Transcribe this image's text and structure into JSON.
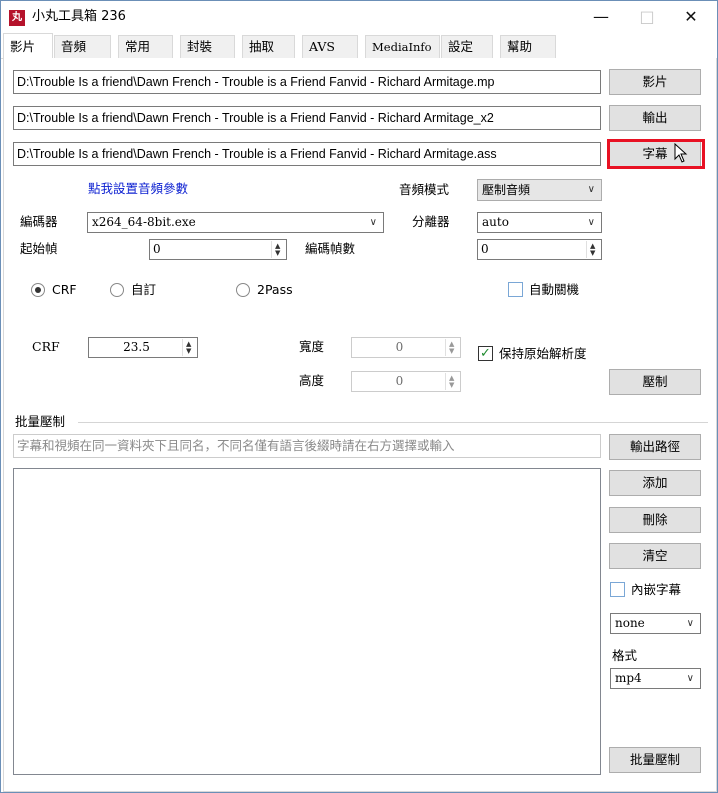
{
  "window": {
    "title": "小丸工具箱 236",
    "icon_text": "丸",
    "controls": {
      "minimize": "—",
      "maximize": "□",
      "close": "✕"
    }
  },
  "tabs": [
    "影片",
    "音頻",
    "常用",
    "封裝",
    "抽取",
    "AVS",
    "MediaInfo",
    "設定",
    "幫助"
  ],
  "video_tab": {
    "video_path": "D:\\Trouble Is a friend\\Dawn French - Trouble is a Friend Fanvid - Richard Armitage.mp",
    "output_path": "D:\\Trouble Is a friend\\Dawn French - Trouble is a Friend Fanvid - Richard Armitage_x2",
    "subtitle_path": "D:\\Trouble Is a friend\\Dawn French - Trouble is a Friend Fanvid - Richard Armitage.ass",
    "video_button": "影片",
    "output_button": "輸出",
    "subtitle_button": "字幕",
    "audio_settings_link": "點我設置音頻參數",
    "audio_mode_label": "音頻模式",
    "audio_mode_value": "壓制音頻",
    "encoder_label": "編碼器",
    "encoder_value": "x264_64-8bit.exe",
    "splitter_label": "分離器",
    "splitter_value": "auto",
    "start_frame_label": "起始幀",
    "start_frame_value": "0",
    "encode_frames_label": "編碼幀數",
    "encode_frames_value": "0",
    "rate_modes": [
      "CRF",
      "自訂",
      "2Pass"
    ],
    "rate_mode_selected": "CRF",
    "auto_shutdown_label": "自動關機",
    "crf_label": "CRF",
    "crf_value": "23.5",
    "width_label": "寬度",
    "width_value": "0",
    "height_label": "高度",
    "height_value": "0",
    "keep_resolution_label": "保持原始解析度",
    "keep_resolution_checked": true,
    "encode_button": "壓制"
  },
  "batch": {
    "group_label": "批量壓制",
    "placeholder": "字幕和視頻在同一資料夾下且同名，不同名僅有語言後綴時請在右方選擇或輸入",
    "output_path_button": "輸出路徑",
    "add_button": "添加",
    "delete_button": "刪除",
    "clear_button": "清空",
    "embed_subtitle_label": "內嵌字幕",
    "embed_subtitle_select": "none",
    "format_label": "格式",
    "format_value": "mp4",
    "batch_encode_button": "批量壓制"
  },
  "colors": {
    "highlight": "#e81123",
    "link": "#0b1fd1",
    "checkmark": "#1e8a2e",
    "app_icon": "#b5122b"
  },
  "icons": {
    "dropdown": "chevron-down-icon",
    "cursor": "mouse-pointer-icon"
  }
}
